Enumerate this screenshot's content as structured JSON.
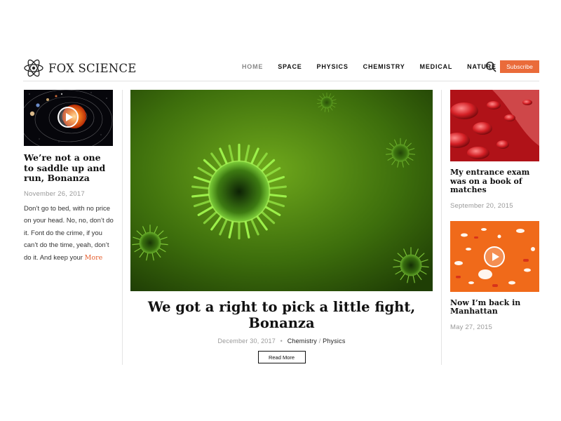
{
  "brand": {
    "name": "FOX SCIENCE",
    "accent": "#ea6b3a"
  },
  "nav": {
    "items": [
      {
        "label": "HOME",
        "active": true
      },
      {
        "label": "SPACE"
      },
      {
        "label": "PHYSICS"
      },
      {
        "label": "CHEMISTRY"
      },
      {
        "label": "MEDICAL"
      },
      {
        "label": "NATURE"
      }
    ],
    "search_icon": "search-icon",
    "subscribe_label": "Subscribe"
  },
  "left_post": {
    "title": "We’re not a one to saddle up and run, Bonanza",
    "date": "November 26, 2017",
    "excerpt": "Don’t go to bed, with no price on your head. No, no, don’t do it. Font do the crime, if you can’t do the time, yeah, don’t do it. And keep your",
    "more_label": "More",
    "media": "video"
  },
  "featured_post": {
    "title": "We got a right to pick a little fight, Bonanza",
    "date": "December 30, 2017",
    "categories": [
      "Chemistry",
      "Physics"
    ],
    "cat_sep": "/",
    "meta_dot": "•",
    "read_more_label": "Read More"
  },
  "right_posts": [
    {
      "title": "My entrance exam was on a book of matches",
      "date": "September 20, 2015",
      "media": "image"
    },
    {
      "title": "Now I’m back in Manhattan",
      "date": "May 27, 2015",
      "media": "video"
    }
  ]
}
